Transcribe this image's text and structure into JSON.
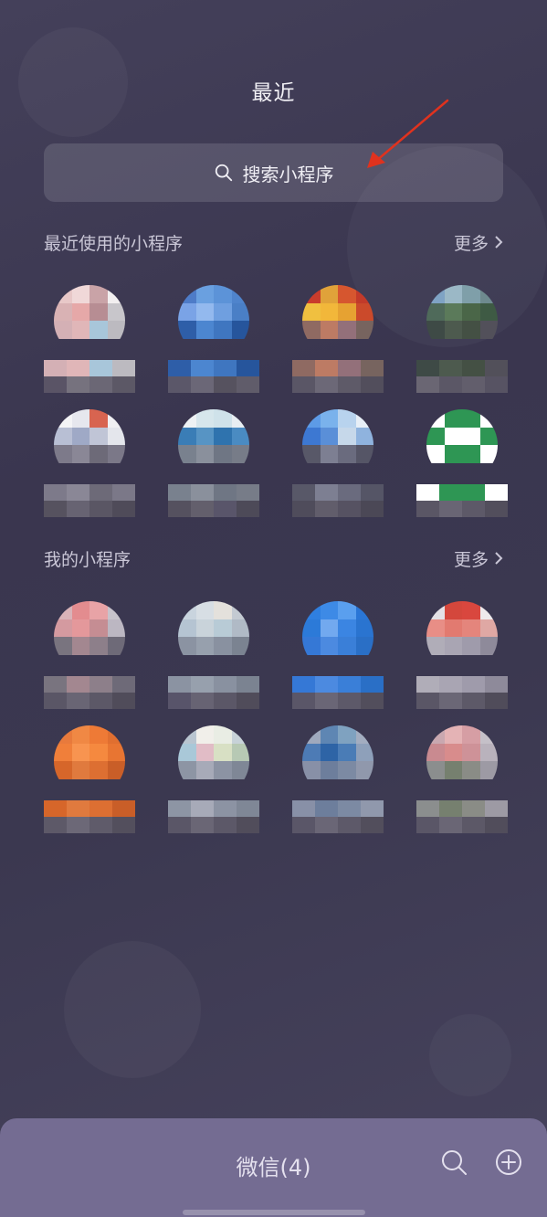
{
  "header": {
    "title": "最近"
  },
  "search": {
    "placeholder": "搜索小程序"
  },
  "recent": {
    "title": "最近使用的小程序",
    "more_label": "更多",
    "apps": [
      {
        "label": "",
        "colors": [
          "#e8c8c8",
          "#f0d8d8",
          "#c9a3a7",
          "#f2eff0",
          "#d9b2b4",
          "#e6a8a8",
          "#b78d93",
          "#c8c6cb",
          "#d4b0b5",
          "#e0b6b8",
          "#a8c6da",
          "#bcbac0",
          "#5a5466",
          "#76727e",
          "#6b6775",
          "#5c5866"
        ]
      },
      {
        "label": "",
        "colors": [
          "#4e7cc8",
          "#6aa0e0",
          "#5c93d8",
          "#4f84cc",
          "#7aa3e6",
          "#93b9ee",
          "#6f9fe0",
          "#4a7fc6",
          "#2e5ea8",
          "#4c86d0",
          "#3f76c0",
          "#26559c",
          "#5b5769",
          "#6b6777",
          "#56525f",
          "#605c6a"
        ]
      },
      {
        "label": "",
        "colors": [
          "#c93c2c",
          "#e0a23a",
          "#d6562f",
          "#c23a2a",
          "#f0c040",
          "#f2b73a",
          "#e6a232",
          "#cb4a2b",
          "#8f6a62",
          "#bd7b64",
          "#93707a",
          "#77645f",
          "#5a5666",
          "#6c6877",
          "#5e5a68",
          "#524e5c"
        ]
      },
      {
        "label": "",
        "colors": [
          "#7fa3c4",
          "#9bb8c6",
          "#7f9fa9",
          "#6e8a8f",
          "#4f6a5a",
          "#5b7a5a",
          "#4a6648",
          "#3e5a44",
          "#3e4a46",
          "#4d5a4e",
          "#445044",
          "#52505a",
          "#6a6673",
          "#5b5766",
          "#625e6c",
          "#575363"
        ]
      },
      {
        "label": "",
        "colors": [
          "#f4f4f6",
          "#e6e7ee",
          "#d86450",
          "#f0f0f3",
          "#b8bfd4",
          "#9fa9c6",
          "#c0c5d6",
          "#e4e6ec",
          "#7d7a8a",
          "#8a8796",
          "#6d6a78",
          "#7b7888",
          "#56525f",
          "#676372",
          "#5a5664",
          "#4f4b59"
        ]
      },
      {
        "label": "",
        "colors": [
          "#eef2f4",
          "#d6e6ec",
          "#cfe2ea",
          "#e8eef2",
          "#3a7db6",
          "#5794c4",
          "#2f73ae",
          "#4a8bc2",
          "#79818e",
          "#8a909c",
          "#6f7684",
          "#777c88",
          "#55515f",
          "#635f6c",
          "#59556a",
          "#4d4a58"
        ]
      },
      {
        "label": "",
        "colors": [
          "#5d9be6",
          "#7ab2ec",
          "#b8d3ee",
          "#e7eff7",
          "#3d78d2",
          "#5a8fd8",
          "#c6d8ea",
          "#8fb3de",
          "#585868",
          "#7d7f92",
          "#6a6b7e",
          "#555566",
          "#4f4c5b",
          "#615d6b",
          "#565262",
          "#4b4856"
        ]
      },
      {
        "label": "",
        "colors": [
          "#ffffff",
          "#2e9654",
          "#2e9654",
          "#ffffff",
          "#2e9654",
          "#ffffff",
          "#ffffff",
          "#2e9654",
          "#ffffff",
          "#2e9654",
          "#2e9654",
          "#ffffff",
          "#5a5665",
          "#696574",
          "#5d5968",
          "#524e5c"
        ]
      }
    ]
  },
  "mine": {
    "title": "我的小程序",
    "more_label": "更多",
    "apps": [
      {
        "label": "",
        "colors": [
          "#d9b3b8",
          "#e38c8f",
          "#e8a3a6",
          "#c7c3cb",
          "#d49aa0",
          "#e4989b",
          "#c58d93",
          "#bcb7c2",
          "#79747f",
          "#a38790",
          "#8d7f8a",
          "#6e6a78",
          "#5a5666",
          "#696574",
          "#5c5867",
          "#504c5a"
        ]
      },
      {
        "label": "",
        "colors": [
          "#c9d4de",
          "#d7dee4",
          "#e4e1dc",
          "#c4cad2",
          "#b5c4d2",
          "#c9d3da",
          "#b8cbd6",
          "#b0bac6",
          "#8b93a2",
          "#97a0ad",
          "#8991a0",
          "#7b8391",
          "#58546a",
          "#676373",
          "#5b5767",
          "#504c5a"
        ]
      },
      {
        "label": "",
        "colors": [
          "#2f7fe0",
          "#3d8ae6",
          "#5a9fee",
          "#2a76d6",
          "#2c7ad8",
          "#72a9ef",
          "#3b85e2",
          "#2a74d0",
          "#3578d6",
          "#4c8ae0",
          "#3a7fd8",
          "#2a6fc6",
          "#5a5668",
          "#6a6676",
          "#5d5969",
          "#524e5c"
        ]
      },
      {
        "label": "",
        "colors": [
          "#e4e2e6",
          "#d4473c",
          "#d9473e",
          "#eeeaec",
          "#e88e86",
          "#e27a70",
          "#e4857c",
          "#dfa8a4",
          "#b0adb8",
          "#a9a5b3",
          "#9f9bab",
          "#8e8a9a",
          "#5a5666",
          "#6b6776",
          "#5d5968",
          "#504c5a"
        ]
      },
      {
        "label": "",
        "colors": [
          "#e87a3c",
          "#f08844",
          "#ee7a36",
          "#e06f30",
          "#f07f3a",
          "#f89450",
          "#f5893f",
          "#e87532",
          "#d6662a",
          "#e07a3e",
          "#dd6f32",
          "#c95e28",
          "#5d5968",
          "#6c6877",
          "#5f5b6a",
          "#534f5d"
        ]
      },
      {
        "label": "",
        "colors": [
          "#b9c5d0",
          "#f1efea",
          "#e9ede4",
          "#c7d2d8",
          "#a9c8d8",
          "#e1bcc6",
          "#d8e0c4",
          "#b7c9b4",
          "#8d95a4",
          "#a7aab8",
          "#8c93a3",
          "#7f8796",
          "#5a5667",
          "#6a6675",
          "#5c5868",
          "#514d5b"
        ]
      },
      {
        "label": "",
        "colors": [
          "#9fa9bd",
          "#5e86b3",
          "#7fa2c0",
          "#a3adc0",
          "#4d7bb5",
          "#2e64a6",
          "#4a7cb6",
          "#8ea0ba",
          "#8890a7",
          "#6d7e9c",
          "#7c8aa3",
          "#9098ac",
          "#5a5668",
          "#6a6676",
          "#5d5969",
          "#524e5c"
        ]
      },
      {
        "label": "",
        "colors": [
          "#c9a8b0",
          "#e4b3b5",
          "#d69ea4",
          "#c5c0c8",
          "#c98a90",
          "#d88c8c",
          "#ce9298",
          "#b9b2bc",
          "#8b8e8e",
          "#76806f",
          "#8a8c86",
          "#9d9aa4",
          "#5a5667",
          "#6a6675",
          "#5c5867",
          "#514d5b"
        ]
      }
    ]
  },
  "bottom": {
    "title": "微信(4)"
  },
  "colors": {
    "background": "#3d3a52",
    "bottom_bar": "#746c92",
    "arrow": "#e0321e"
  }
}
